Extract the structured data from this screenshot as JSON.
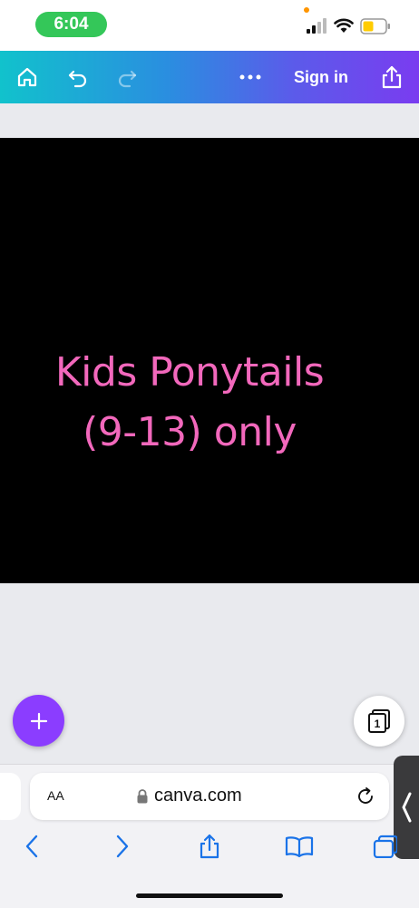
{
  "status_bar": {
    "time": "6:04"
  },
  "toolbar": {
    "sign_in_label": "Sign in"
  },
  "design": {
    "title_line1": "Kids Ponytails",
    "title_line2": "(9-13) only"
  },
  "pages": {
    "count": "1"
  },
  "browser": {
    "text_size_label": "AA",
    "url": "canva.com"
  },
  "colors": {
    "accent_purple": "#8b3dff",
    "design_text": "#ff6ec7",
    "link_blue": "#1a73e8"
  }
}
